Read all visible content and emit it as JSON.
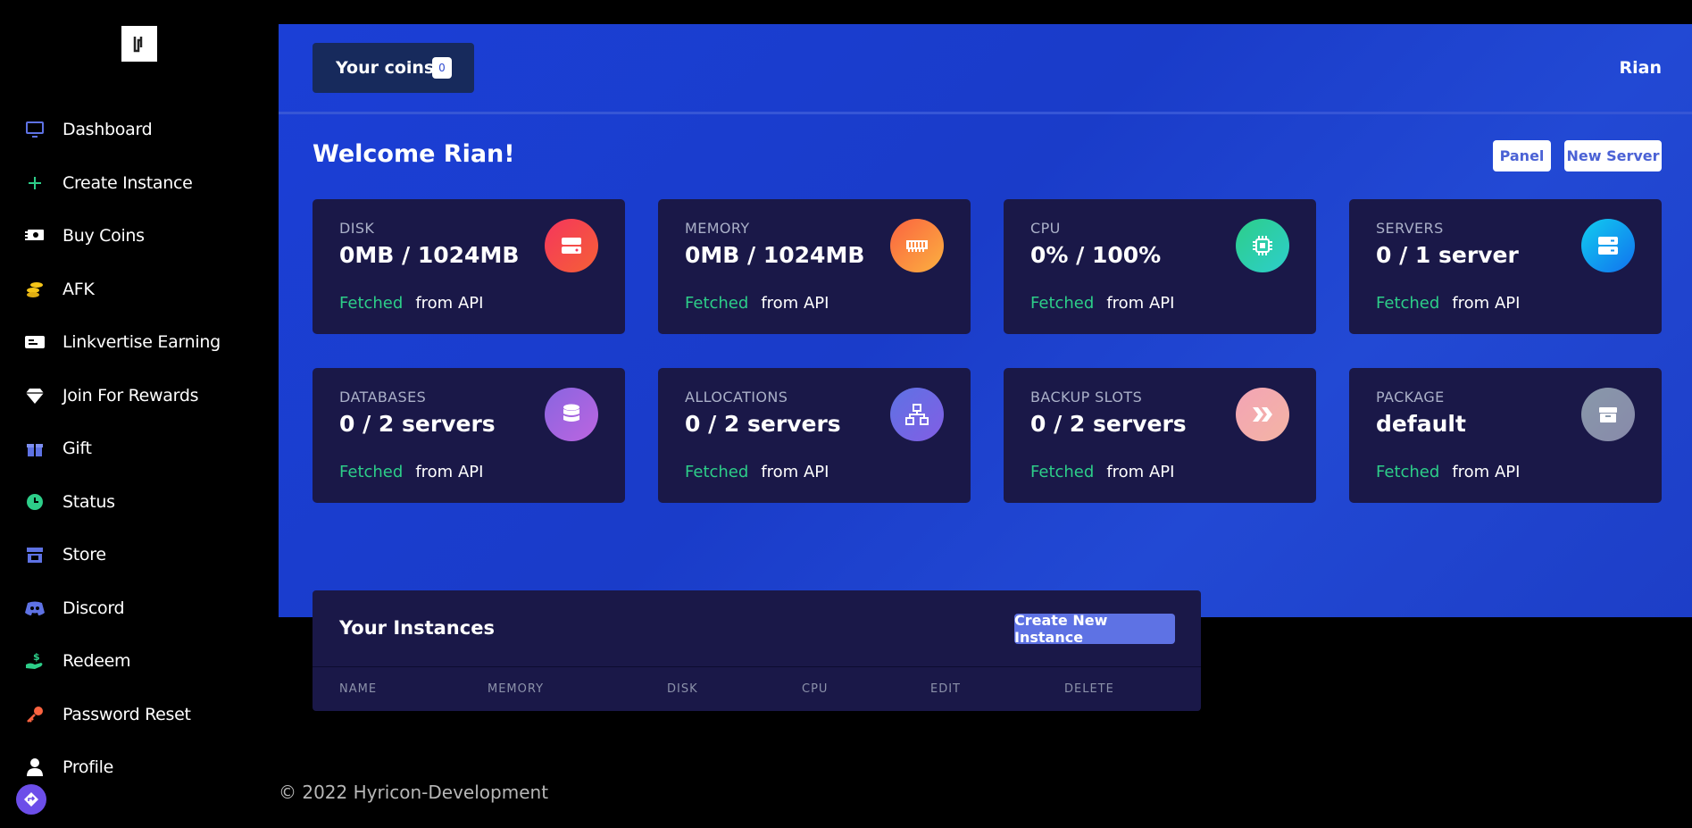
{
  "sidebar": {
    "logo_icon": "brand-logo-icon",
    "items": [
      {
        "label": "Dashboard",
        "icon": "monitor-icon",
        "color": "#5e72e4"
      },
      {
        "label": "Create Instance",
        "icon": "plus-icon",
        "color": "#2dce89"
      },
      {
        "label": "Buy Coins",
        "icon": "cash-icon",
        "color": "#ffffff"
      },
      {
        "label": "AFK",
        "icon": "coins-icon",
        "color": "#f5c518"
      },
      {
        "label": "Linkvertise Earning",
        "icon": "id-card-icon",
        "color": "#ffffff"
      },
      {
        "label": "Join For Rewards",
        "icon": "diamond-icon",
        "color": "#ffffff"
      },
      {
        "label": "Gift",
        "icon": "gift-icon",
        "color": "#5e72e4"
      },
      {
        "label": "Status",
        "icon": "clock-icon",
        "color": "#2dce89"
      },
      {
        "label": "Store",
        "icon": "store-icon",
        "color": "#5e72e4"
      },
      {
        "label": "Discord",
        "icon": "discord-icon",
        "color": "#5e72e4"
      },
      {
        "label": "Redeem",
        "icon": "hand-money-icon",
        "color": "#2dce89"
      },
      {
        "label": "Password Reset",
        "icon": "key-icon",
        "color": "#fb6340"
      },
      {
        "label": "Profile",
        "icon": "user-icon",
        "color": "#ffffff"
      }
    ]
  },
  "header": {
    "coins_label": "Your coins",
    "coins_count": "0",
    "username": "Rian"
  },
  "main": {
    "welcome": "Welcome Rian!",
    "panel_button": "Panel",
    "new_server_button": "New Server",
    "cards": [
      {
        "title": "DISK",
        "value": "0MB / 1024MB",
        "fetched": "Fetched",
        "from": "from",
        "api": "API",
        "icon": "hard-drive-icon",
        "gradient": [
          "#f5365c",
          "#f56036"
        ]
      },
      {
        "title": "MEMORY",
        "value": "0MB / 1024MB",
        "fetched": "Fetched",
        "from": "from",
        "api": "API",
        "icon": "memory-icon",
        "gradient": [
          "#fb6340",
          "#fbb140"
        ]
      },
      {
        "title": "CPU",
        "value": "0% / 100%",
        "fetched": "Fetched",
        "from": "from",
        "api": "API",
        "icon": "cpu-icon",
        "gradient": [
          "#2dce89",
          "#2dcecc"
        ]
      },
      {
        "title": "SERVERS",
        "value": "0 / 1 server",
        "fetched": "Fetched",
        "from": "from",
        "api": "API",
        "icon": "server-icon",
        "gradient": [
          "#11cdef",
          "#1171ef"
        ]
      },
      {
        "title": "DATABASES",
        "value": "0 / 2 servers",
        "fetched": "Fetched",
        "from": "from",
        "api": "API",
        "icon": "database-icon",
        "gradient": [
          "#8965e0",
          "#bc65e0"
        ]
      },
      {
        "title": "ALLOCATIONS",
        "value": "0 / 2 servers",
        "fetched": "Fetched",
        "from": "from",
        "api": "API",
        "icon": "network-icon",
        "gradient": [
          "#5e72e4",
          "#825ee4"
        ]
      },
      {
        "title": "BACKUP SLOTS",
        "value": "0 / 2 servers",
        "fetched": "Fetched",
        "from": "from",
        "api": "API",
        "icon": "backup-icon",
        "gradient": [
          "#f3a4b5",
          "#f3b4a4"
        ]
      },
      {
        "title": "PACKAGE",
        "value": "default",
        "fetched": "Fetched",
        "from": "from",
        "api": "API",
        "icon": "package-icon",
        "gradient": [
          "#8898aa",
          "#888aaa"
        ]
      }
    ]
  },
  "instances": {
    "title": "Your Instances",
    "create_button": "Create New Instance",
    "columns": [
      "NAME",
      "MEMORY",
      "DISK",
      "CPU",
      "EDIT",
      "DELETE"
    ]
  },
  "footer": {
    "copyright": "© 2022 Hyricon-Development"
  },
  "help_icon": "diamond-turn-icon"
}
